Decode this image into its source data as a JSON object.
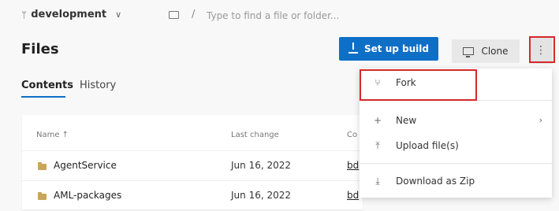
{
  "header": {
    "branch": "development",
    "path_placeholder": "Type to find a file or folder...",
    "path_separator": "/"
  },
  "page": {
    "title": "Files"
  },
  "toolbar": {
    "build_label": "Set up build",
    "clone_label": "Clone",
    "more_label": "⋮"
  },
  "tabs": [
    {
      "label": "Contents",
      "active": true
    },
    {
      "label": "History",
      "active": false
    }
  ],
  "table": {
    "columns": [
      "Name ↑",
      "Last change",
      "Co"
    ],
    "rows": [
      {
        "name": "AgentService",
        "last_change": "Jun 16, 2022",
        "commit": "bd"
      },
      {
        "name": "AML-packages",
        "last_change": "Jun 16, 2022",
        "commit": "bd"
      }
    ]
  },
  "menu": {
    "items": [
      {
        "label": "Fork",
        "icon": "fork-icon"
      },
      {
        "label": "New",
        "icon": "plus-icon",
        "has_submenu": true
      },
      {
        "label": "Upload file(s)",
        "icon": "upload-icon"
      },
      {
        "label": "Download as Zip",
        "icon": "download-icon"
      }
    ]
  },
  "colors": {
    "accent": "#0e6fc7",
    "highlight": "#d42a2a"
  }
}
